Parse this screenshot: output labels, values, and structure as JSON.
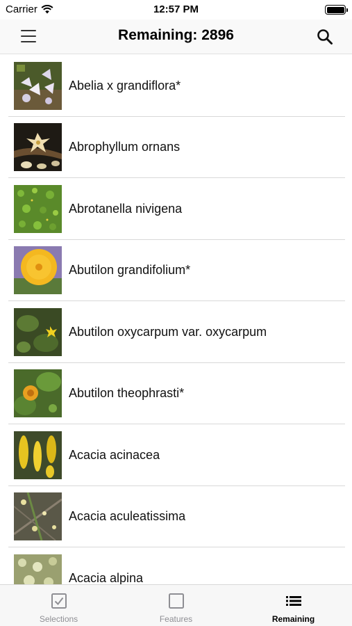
{
  "status_bar": {
    "carrier": "Carrier",
    "time": "12:57 PM"
  },
  "nav": {
    "title": "Remaining: 2896",
    "menu_icon": "hamburger-menu-icon",
    "search_icon": "search-icon"
  },
  "list": {
    "items": [
      {
        "label": "Abelia x grandiflora*"
      },
      {
        "label": "Abrophyllum ornans"
      },
      {
        "label": "Abrotanella nivigena"
      },
      {
        "label": "Abutilon grandifolium*"
      },
      {
        "label": "Abutilon oxycarpum var. oxycarpum"
      },
      {
        "label": "Abutilon theophrasti*"
      },
      {
        "label": "Acacia acinacea"
      },
      {
        "label": "Acacia aculeatissima"
      },
      {
        "label": "Acacia alpina"
      }
    ]
  },
  "tabs": [
    {
      "label": "Selections",
      "icon": "checkbox-checked-icon",
      "active": false
    },
    {
      "label": "Features",
      "icon": "checkbox-empty-icon",
      "active": false
    },
    {
      "label": "Remaining",
      "icon": "list-icon",
      "active": true
    }
  ],
  "colors": {
    "nav_background": "#f9f9f9",
    "tab_inactive": "#8e8e93",
    "tab_active": "#000000",
    "separator": "#d8d8d8"
  }
}
